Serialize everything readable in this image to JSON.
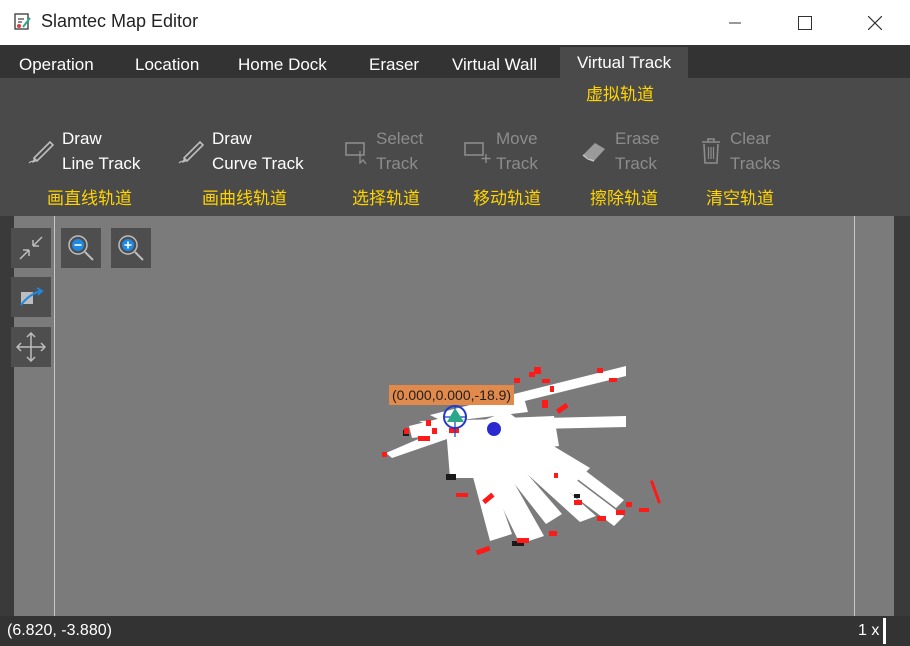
{
  "window": {
    "title": "Slamtec Map Editor",
    "icons": {
      "app": "map-editor-icon",
      "minimize": "minimize-icon",
      "maximize": "maximize-icon",
      "close": "close-icon"
    }
  },
  "tabs": [
    {
      "label": "Operation",
      "active": false
    },
    {
      "label": "Location",
      "active": false
    },
    {
      "label": "Home Dock",
      "active": false
    },
    {
      "label": "Eraser",
      "active": false
    },
    {
      "label": "Virtual Wall",
      "active": false
    },
    {
      "label": "Virtual Track",
      "active": true
    }
  ],
  "active_tab_cn": "虚拟轨道",
  "tools": [
    {
      "line1": "Draw",
      "line2": "Line Track",
      "cn": "画直线轨道",
      "icon": "pen-icon",
      "enabled": true
    },
    {
      "line1": "Draw",
      "line2": "Curve Track",
      "cn": "画曲线轨道",
      "icon": "pen-icon",
      "enabled": true
    },
    {
      "line1": "Select",
      "line2": "Track",
      "cn": "选择轨道",
      "icon": "select-icon",
      "enabled": false
    },
    {
      "line1": "Move",
      "line2": "Track",
      "cn": "移动轨道",
      "icon": "move-icon",
      "enabled": false
    },
    {
      "line1": "Erase",
      "line2": "Track",
      "cn": "擦除轨道",
      "icon": "eraser-icon",
      "enabled": false
    },
    {
      "line1": "Clear",
      "line2": "Tracks",
      "cn": "清空轨道",
      "icon": "trash-icon",
      "enabled": false
    }
  ],
  "map": {
    "pose_label": "(0.000,0.000,-18.9)",
    "controls": [
      "fit-to-window-icon",
      "zoom-out-icon",
      "zoom-in-icon",
      "reset-view-icon",
      "pan-icon"
    ],
    "colors": {
      "background": "#7b7b7b",
      "free_space": "#ffffff",
      "obstacle": "#ff0000",
      "robot": "#2aa889",
      "dock": "#2a2ad0"
    }
  },
  "status": {
    "cursor_coords": "(6.820, -3.880)",
    "zoom_level": "1 x"
  }
}
